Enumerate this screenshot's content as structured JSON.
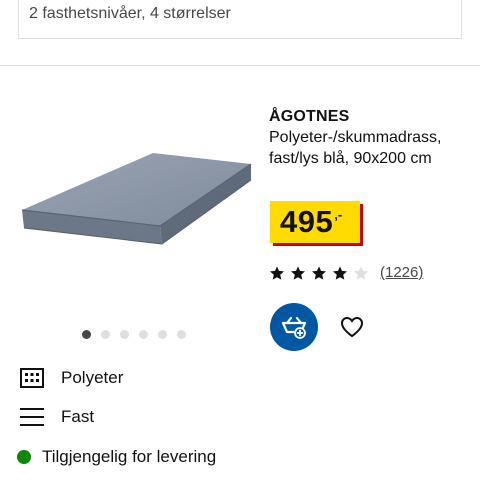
{
  "top_card": {
    "text": "2 fasthetsnivåer, 4 størrelser"
  },
  "product": {
    "name": "ÅGOTNES",
    "description": "Polyeter-/skummadrass, fast/lys blå, 90x200 cm",
    "price": {
      "value": "495",
      "suffix": ",-"
    },
    "rating": {
      "stars": 4,
      "max": 5,
      "count": "(1226)"
    },
    "image_dots": {
      "total": 6,
      "active": 0
    }
  },
  "features": [
    {
      "icon": "grid-icon",
      "label": "Polyeter"
    },
    {
      "icon": "firmness-lines-icon",
      "label": "Fast"
    }
  ],
  "availability": {
    "label": "Tilgjengelig for levering",
    "status_color": "#0a8a00"
  },
  "colors": {
    "price_bg": "#ffdb00",
    "price_shadow": "#cc0008",
    "cart_bg": "#0058a3",
    "mattress": "#8a95a6"
  }
}
